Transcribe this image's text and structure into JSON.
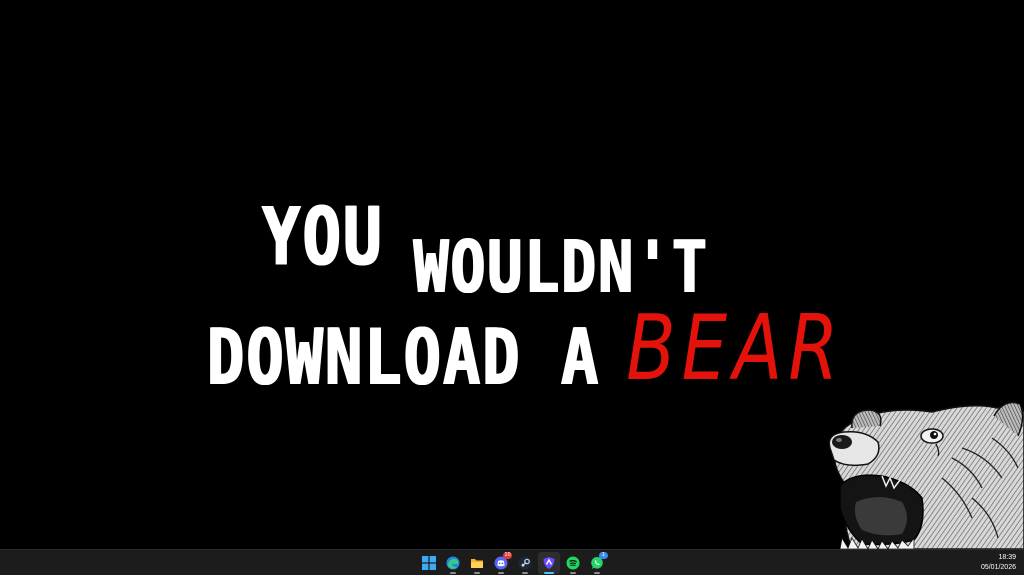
{
  "wallpaper": {
    "line1_word1": "YOU",
    "line1_word2": "WOULDN'T",
    "line2_word1": "DOWNLOAD",
    "line2_word2": "A",
    "line2_word3": "BEAR",
    "accent_color": "#e3120b"
  },
  "taskbar": {
    "apps": [
      {
        "icon": "windows-start-icon"
      },
      {
        "icon": "edge-icon"
      },
      {
        "icon": "file-explorer-icon"
      },
      {
        "icon": "discord-icon",
        "badge": "10"
      },
      {
        "icon": "steam-icon"
      },
      {
        "icon": "vpn-shield-icon"
      },
      {
        "icon": "spotify-icon"
      },
      {
        "icon": "whatsapp-icon",
        "badge": "1"
      }
    ],
    "time": "18:39",
    "date": "05/01/2026"
  }
}
